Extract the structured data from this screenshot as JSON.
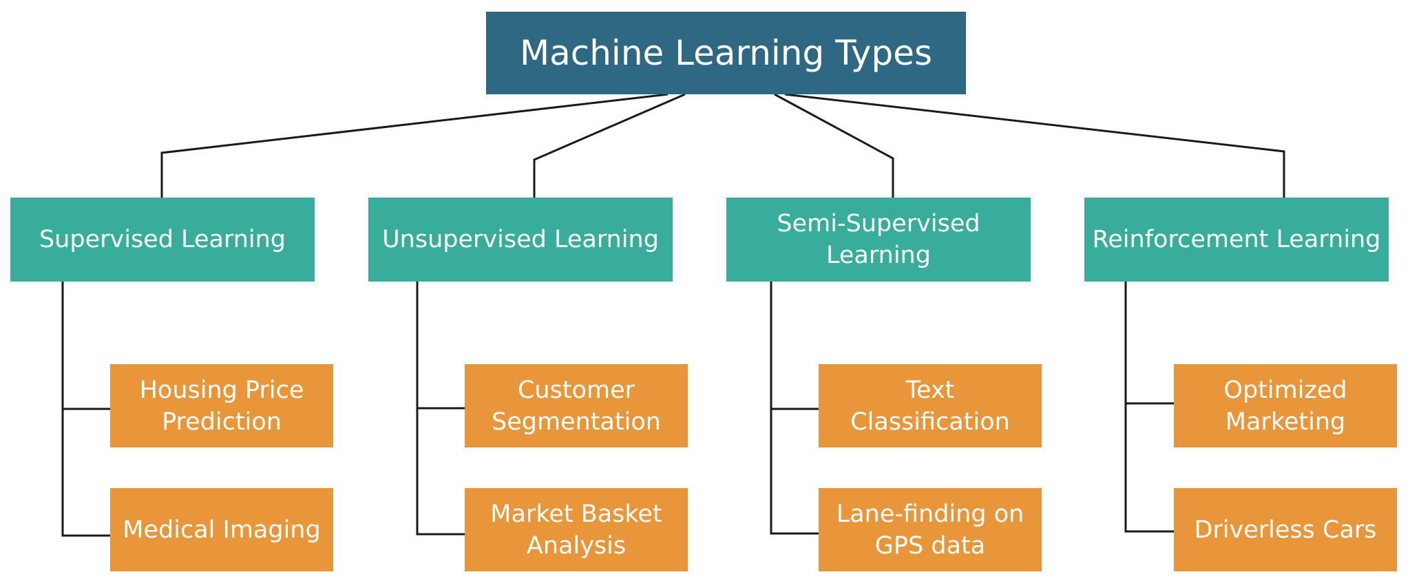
{
  "title": "Machine Learning Types",
  "colors": {
    "root": "#2f6882",
    "category": "#38ad9b",
    "example": "#e9963a",
    "connector": "#1a1a1a",
    "text": "#ffffff"
  },
  "categories": [
    {
      "label": "Supervised Learning",
      "examples": [
        "Housing Price Prediction",
        "Medical Imaging"
      ]
    },
    {
      "label": "Unsupervised Learning",
      "examples": [
        "Customer Segmentation",
        "Market Basket Analysis"
      ]
    },
    {
      "label": "Semi-Supervised Learning",
      "examples": [
        "Text Classification",
        "Lane-finding on GPS data"
      ]
    },
    {
      "label": "Reinforcement Learning",
      "examples": [
        "Optimized Marketing",
        "Driverless Cars"
      ]
    }
  ]
}
